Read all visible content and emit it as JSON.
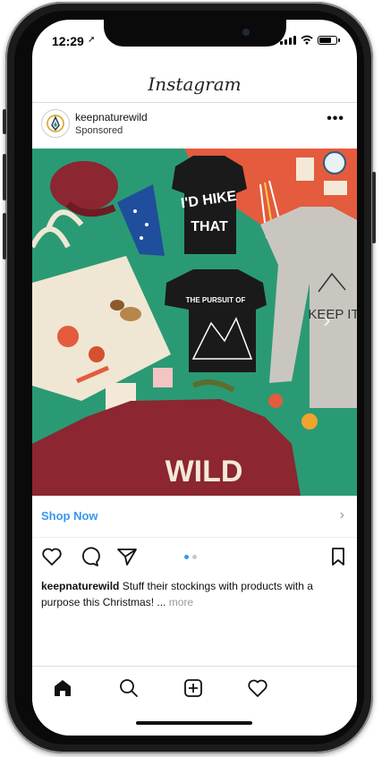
{
  "status": {
    "time": "12:29"
  },
  "app": {
    "title": "Instagram"
  },
  "post": {
    "username": "keepnaturewild",
    "label": "Sponsored",
    "more": "•••",
    "image_text": {
      "shirt": "I'D HIKE THAT",
      "tee": "THE PURSUIT OF",
      "sweater": "WILD",
      "longsleeve": "KEEP IT"
    },
    "cta": "Shop Now",
    "cta_chevron": "›",
    "caption_user": "keepnaturewild",
    "caption_text": " Stuff their stockings with products with a purpose this Christmas! ... ",
    "caption_more": "more",
    "carousel": {
      "count": 2,
      "active": 1
    }
  },
  "icons": [
    "heart-icon",
    "comment-icon",
    "share-icon",
    "bookmark-icon",
    "home-icon",
    "search-icon",
    "add-post-icon",
    "activity-heart-icon"
  ],
  "colors": {
    "link": "#3897f0",
    "photo_bg": "#2a9a75",
    "coral": "#e45b3e",
    "maroon": "#8c2630"
  }
}
